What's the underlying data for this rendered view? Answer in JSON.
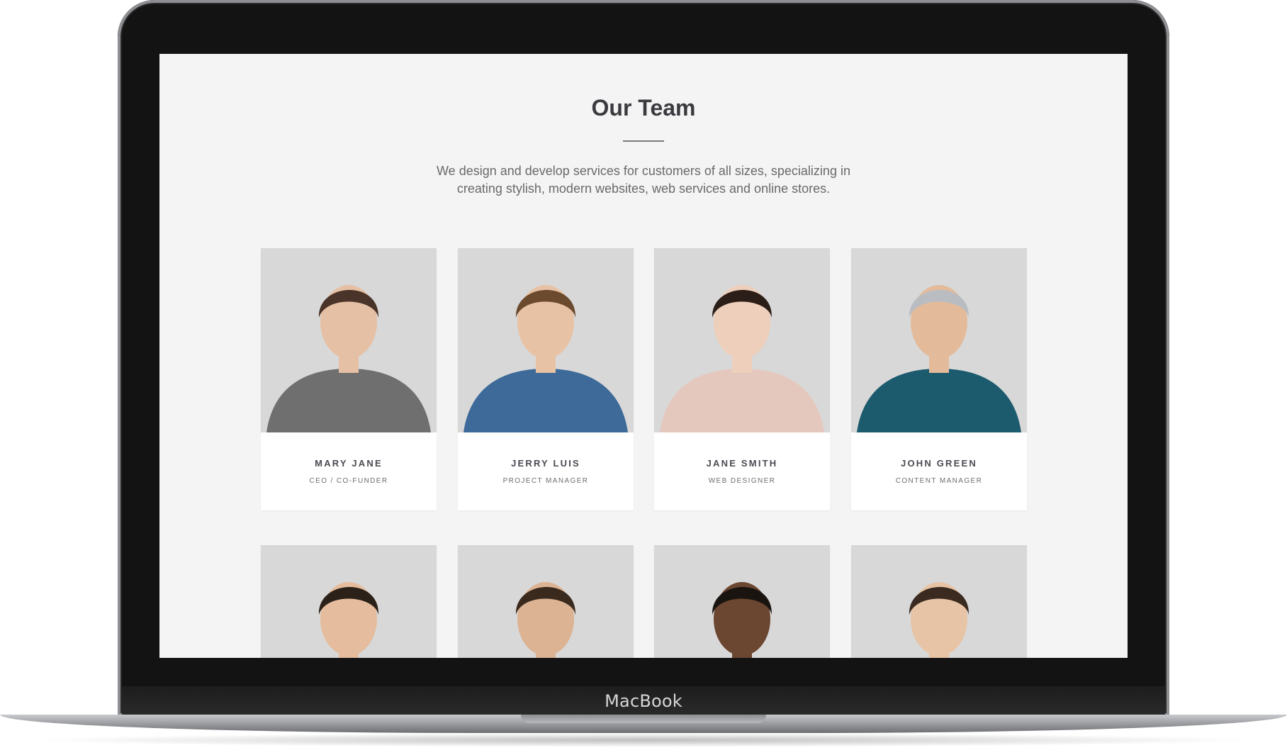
{
  "device": {
    "brand_label": "MacBook"
  },
  "page": {
    "title": "Our Team",
    "subtitle_line1": "We design and develop services for customers of all sizes, specializing in",
    "subtitle_line2": "creating stylish, modern websites, web services and online stores."
  },
  "team": [
    {
      "name": "MARY JANE",
      "role": "CEO / CO-FUNDER",
      "shirt": "#6f6f6f",
      "hair": "#4a3328",
      "skin": "#e6c0a4"
    },
    {
      "name": "JERRY LUIS",
      "role": "PROJECT MANAGER",
      "shirt": "#3d6a99",
      "hair": "#6b4a2e",
      "skin": "#e8c2a5"
    },
    {
      "name": "JANE SMITH",
      "role": "WEB DESIGNER",
      "shirt": "#e5c8bd",
      "hair": "#2b1d18",
      "skin": "#edcfbb"
    },
    {
      "name": "JOHN GREEN",
      "role": "CONTENT MANAGER",
      "shirt": "#1c5a6e",
      "hair": "#b9bdc2",
      "skin": "#e4bb9a"
    },
    {
      "name": "",
      "role": "",
      "shirt": "#4a4a4a",
      "hair": "#2b2118",
      "skin": "#e5bd9e"
    },
    {
      "name": "",
      "role": "",
      "shirt": "#3c4a5c",
      "hair": "#3a2a1e",
      "skin": "#dcb393"
    },
    {
      "name": "",
      "role": "",
      "shirt": "#2f2f2f",
      "hair": "#1a1410",
      "skin": "#6b4630"
    },
    {
      "name": "",
      "role": "",
      "shirt": "#1e2633",
      "hair": "#3a2a20",
      "skin": "#e8c4a6"
    }
  ]
}
